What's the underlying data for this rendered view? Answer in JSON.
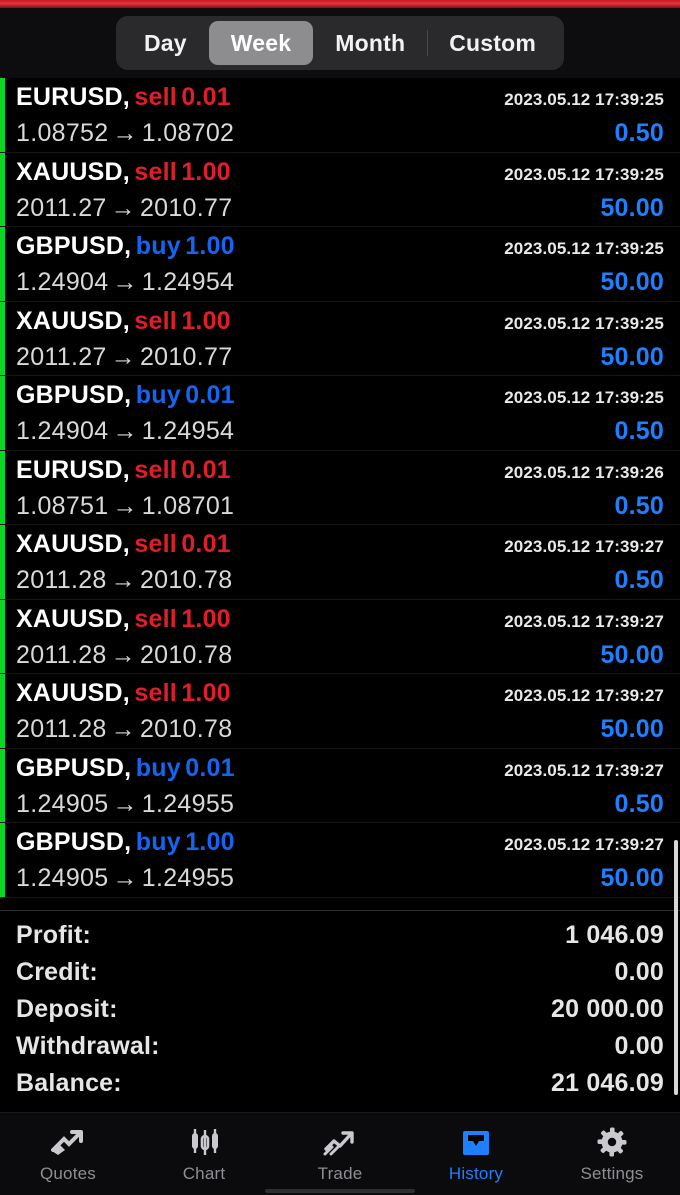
{
  "period_filter": {
    "options": [
      {
        "label": "Day",
        "selected": false
      },
      {
        "label": "Week",
        "selected": true
      },
      {
        "label": "Month",
        "selected": false
      },
      {
        "label": "Custom",
        "selected": false
      }
    ]
  },
  "colors": {
    "sell": "#e01e28",
    "buy": "#1565f0",
    "profit": "#1e7fff",
    "accent_bar": "#0cd723",
    "top_strip": "#e8323c",
    "nav_active": "#1e7fff"
  },
  "deals": [
    {
      "symbol": "EURUSD,",
      "side": "sell",
      "volume": "0.01",
      "open_price": "1.08752",
      "close_price": "1.08702",
      "time": "2023.05.12 17:39:25",
      "profit": "0.50"
    },
    {
      "symbol": "XAUUSD,",
      "side": "sell",
      "volume": "1.00",
      "open_price": "2011.27",
      "close_price": "2010.77",
      "time": "2023.05.12 17:39:25",
      "profit": "50.00"
    },
    {
      "symbol": "GBPUSD,",
      "side": "buy",
      "volume": "1.00",
      "open_price": "1.24904",
      "close_price": "1.24954",
      "time": "2023.05.12 17:39:25",
      "profit": "50.00"
    },
    {
      "symbol": "XAUUSD,",
      "side": "sell",
      "volume": "1.00",
      "open_price": "2011.27",
      "close_price": "2010.77",
      "time": "2023.05.12 17:39:25",
      "profit": "50.00"
    },
    {
      "symbol": "GBPUSD,",
      "side": "buy",
      "volume": "0.01",
      "open_price": "1.24904",
      "close_price": "1.24954",
      "time": "2023.05.12 17:39:25",
      "profit": "0.50"
    },
    {
      "symbol": "EURUSD,",
      "side": "sell",
      "volume": "0.01",
      "open_price": "1.08751",
      "close_price": "1.08701",
      "time": "2023.05.12 17:39:26",
      "profit": "0.50"
    },
    {
      "symbol": "XAUUSD,",
      "side": "sell",
      "volume": "0.01",
      "open_price": "2011.28",
      "close_price": "2010.78",
      "time": "2023.05.12 17:39:27",
      "profit": "0.50"
    },
    {
      "symbol": "XAUUSD,",
      "side": "sell",
      "volume": "1.00",
      "open_price": "2011.28",
      "close_price": "2010.78",
      "time": "2023.05.12 17:39:27",
      "profit": "50.00"
    },
    {
      "symbol": "XAUUSD,",
      "side": "sell",
      "volume": "1.00",
      "open_price": "2011.28",
      "close_price": "2010.78",
      "time": "2023.05.12 17:39:27",
      "profit": "50.00"
    },
    {
      "symbol": "GBPUSD,",
      "side": "buy",
      "volume": "0.01",
      "open_price": "1.24905",
      "close_price": "1.24955",
      "time": "2023.05.12 17:39:27",
      "profit": "0.50"
    },
    {
      "symbol": "GBPUSD,",
      "side": "buy",
      "volume": "1.00",
      "open_price": "1.24905",
      "close_price": "1.24955",
      "time": "2023.05.12 17:39:27",
      "profit": "50.00"
    }
  ],
  "arrow_glyph": "→",
  "summary": [
    {
      "label": "Profit:",
      "value": "1 046.09"
    },
    {
      "label": "Credit:",
      "value": "0.00"
    },
    {
      "label": "Deposit:",
      "value": "20 000.00"
    },
    {
      "label": "Withdrawal:",
      "value": "0.00"
    },
    {
      "label": "Balance:",
      "value": "21 046.09"
    }
  ],
  "nav": [
    {
      "label": "Quotes",
      "icon": "quotes-arrow-icon",
      "active": false
    },
    {
      "label": "Chart",
      "icon": "candlestick-icon",
      "active": false
    },
    {
      "label": "Trade",
      "icon": "trend-arrow-icon",
      "active": false
    },
    {
      "label": "History",
      "icon": "inbox-tray-icon",
      "active": true
    },
    {
      "label": "Settings",
      "icon": "gear-icon",
      "active": false
    }
  ]
}
